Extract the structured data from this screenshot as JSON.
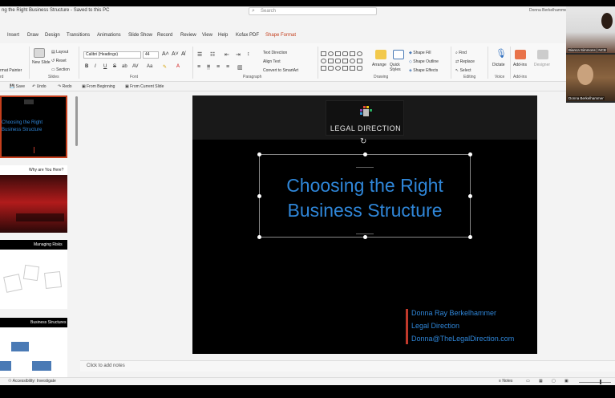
{
  "window": {
    "doc_title": "ng the Right Business Structure - Saved to this PC",
    "search_placeholder": "Search",
    "user": "Donna Berkelhammer"
  },
  "menu": {
    "tabs": [
      "Insert",
      "Draw",
      "Design",
      "Transitions",
      "Animations",
      "Slide Show",
      "Record",
      "Review",
      "View",
      "Help",
      "Kofax PDF",
      "Shape Format"
    ],
    "active_tab": "Shape Format",
    "accent_color": "#c43e1c"
  },
  "ribbon": {
    "slides": {
      "new_slide": "New Slide",
      "layout": "Layout",
      "reset": "Reset",
      "section": "Section",
      "label": "Slides"
    },
    "clipboard": {
      "format_painter": "rmat Painter",
      "label": "rd"
    },
    "font": {
      "name": "Calibri (Headings)",
      "size": "44",
      "label": "Font",
      "buttons": [
        "B",
        "I",
        "U",
        "S",
        "ab",
        "AV",
        "Aa"
      ]
    },
    "paragraph": {
      "text_direction": "Text Direction",
      "align_text": "Align Text",
      "convert_smartart": "Convert to SmartArt",
      "label": "Paragraph"
    },
    "drawing": {
      "arrange": "Arrange",
      "quick_styles": "Quick Styles",
      "shape_fill": "Shape Fill",
      "shape_outline": "Shape Outline",
      "shape_effects": "Shape Effects",
      "label": "Drawing"
    },
    "editing": {
      "find": "Find",
      "replace": "Replace",
      "select": "Select",
      "label": "Editing"
    },
    "voice": {
      "dictate": "Dictate",
      "label": "Voice"
    },
    "addins": {
      "addins": "Add-ins",
      "designer": "Designer",
      "label": "Add-ins"
    }
  },
  "qat": {
    "save": "Save",
    "undo": "Undo",
    "redo": "Redo",
    "from_beginning": "From Beginning",
    "from_current": "From Current Slide"
  },
  "thumbnails": [
    {
      "title": "Choosing the Right Business Structure"
    },
    {
      "title": "Why are You Here?"
    },
    {
      "title": "Managing Risks"
    },
    {
      "title": "Business Structures"
    }
  ],
  "slide": {
    "logo_text": "LEGAL DIRECTION",
    "title_line1": "Choosing the Right",
    "title_line2": "Business Structure",
    "presenter": "Donna Ray Berkelhammer",
    "company": "Legal Direction",
    "email": "Donna@TheLegalDirection.com",
    "title_color": "#2f86d8",
    "bar_color": "#c0392b"
  },
  "notes": {
    "placeholder": "Click to add notes"
  },
  "status": {
    "accessibility": "Accessibility: Investigate",
    "notes": "Notes"
  },
  "video": [
    {
      "name": "Bianca Simmons | NCB"
    },
    {
      "name": "Donna Berkelhammer"
    }
  ]
}
